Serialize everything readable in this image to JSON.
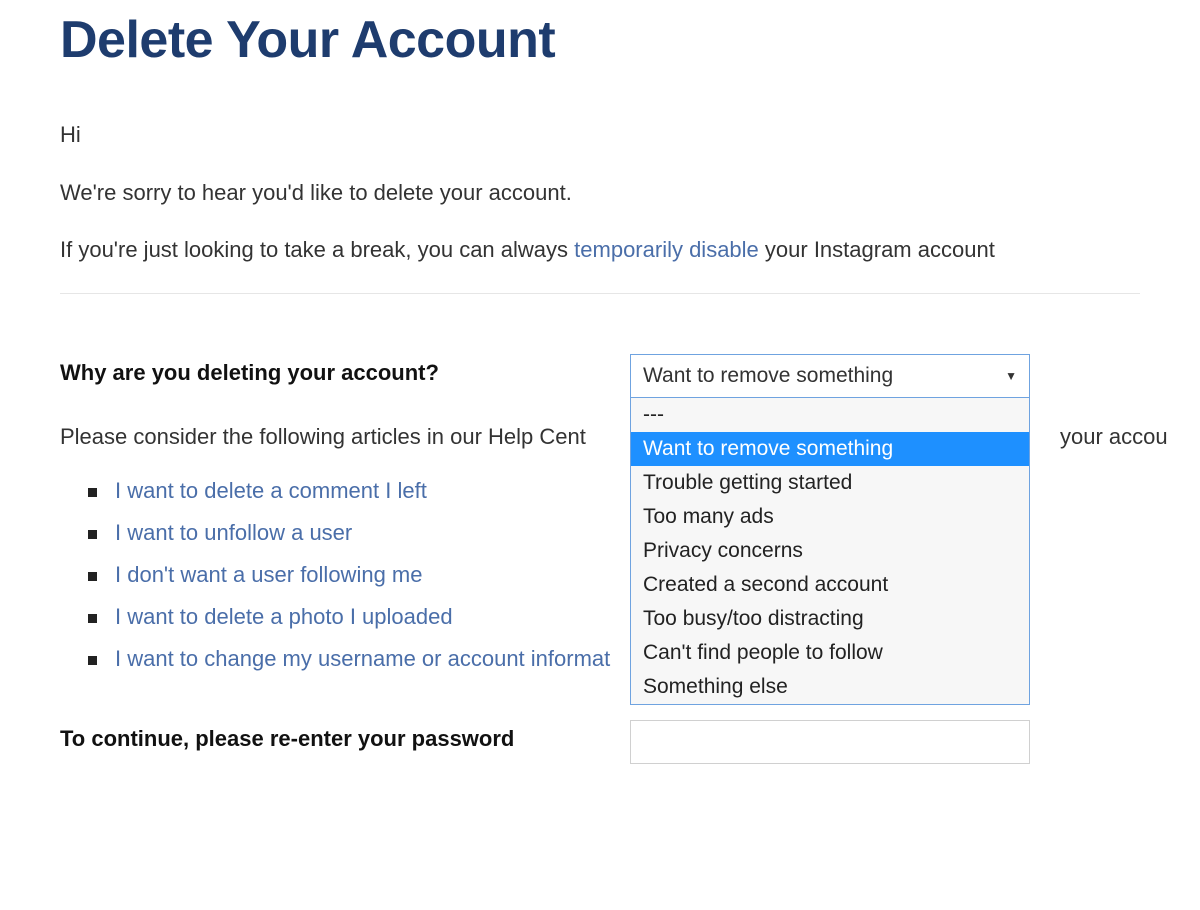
{
  "title": "Delete Your Account",
  "greeting": "Hi",
  "sorry_line": "We're sorry to hear you'd like to delete your account.",
  "break_line_pre": "If you're just looking to take a break, you can always ",
  "break_link": "temporarily disable",
  "break_line_post": " your Instagram account",
  "reason": {
    "label": "Why are you deleting your account?",
    "selected": "Want to remove something",
    "options": [
      "---",
      "Want to remove something",
      "Trouble getting started",
      "Too many ads",
      "Privacy concerns",
      "Created a second account",
      "Too busy/too distracting",
      "Can't find people to follow",
      "Something else"
    ],
    "highlight_index": 1
  },
  "help_intro_visible_left": "Please consider the following articles in our Help Cent",
  "help_intro_visible_right": "your accou",
  "help_articles": [
    "I want to delete a comment I left",
    "I want to unfollow a user",
    "I don't want a user following me",
    "I want to delete a photo I uploaded",
    "I want to change my username or account informat"
  ],
  "password_label": "To continue, please re-enter your password"
}
